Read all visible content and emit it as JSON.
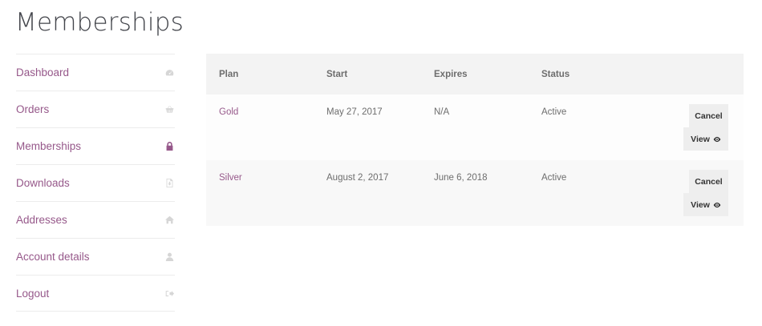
{
  "page": {
    "title": "Memberships"
  },
  "sidebar": {
    "items": [
      {
        "label": "Dashboard",
        "icon": "dashboard-gauge-icon",
        "active": false
      },
      {
        "label": "Orders",
        "icon": "basket-icon",
        "active": false
      },
      {
        "label": "Memberships",
        "icon": "lock-icon",
        "active": true
      },
      {
        "label": "Downloads",
        "icon": "file-download-icon",
        "active": false
      },
      {
        "label": "Addresses",
        "icon": "home-icon",
        "active": false
      },
      {
        "label": "Account details",
        "icon": "user-icon",
        "active": false
      },
      {
        "label": "Logout",
        "icon": "sign-out-icon",
        "active": false
      }
    ]
  },
  "table": {
    "headers": [
      "Plan",
      "Start",
      "Expires",
      "Status"
    ],
    "rows": [
      {
        "plan": "Gold",
        "start": "May 27, 2017",
        "expires": "N/A",
        "status": "Active",
        "cancel_label": "Cancel",
        "view_label": "View"
      },
      {
        "plan": "Silver",
        "start": "August 2, 2017",
        "expires": "June 6, 2018",
        "status": "Active",
        "cancel_label": "Cancel",
        "view_label": "View"
      }
    ]
  },
  "colors": {
    "accent": "#96588a",
    "header_bg": "#f3f3f3",
    "button_bg": "#eeeeee"
  }
}
